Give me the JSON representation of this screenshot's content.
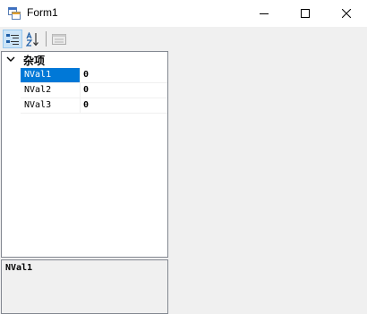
{
  "window": {
    "title": "Form1"
  },
  "toolbar": {
    "categorized_icon": "categorized-icon",
    "alphabetical_icon": "alphabetical-sort-icon",
    "property_pages_icon": "property-pages-icon"
  },
  "grid": {
    "category": {
      "label": "杂项",
      "expanded": true
    },
    "properties": [
      {
        "name": "NVal1",
        "value": "0",
        "selected": true
      },
      {
        "name": "NVal2",
        "value": "0",
        "selected": false
      },
      {
        "name": "NVal3",
        "value": "0",
        "selected": false
      }
    ]
  },
  "help": {
    "title": "NVal1",
    "description": ""
  },
  "colors": {
    "selection": "#0078d7",
    "toolbar_active": "#cce4f7",
    "border": "#828790"
  }
}
